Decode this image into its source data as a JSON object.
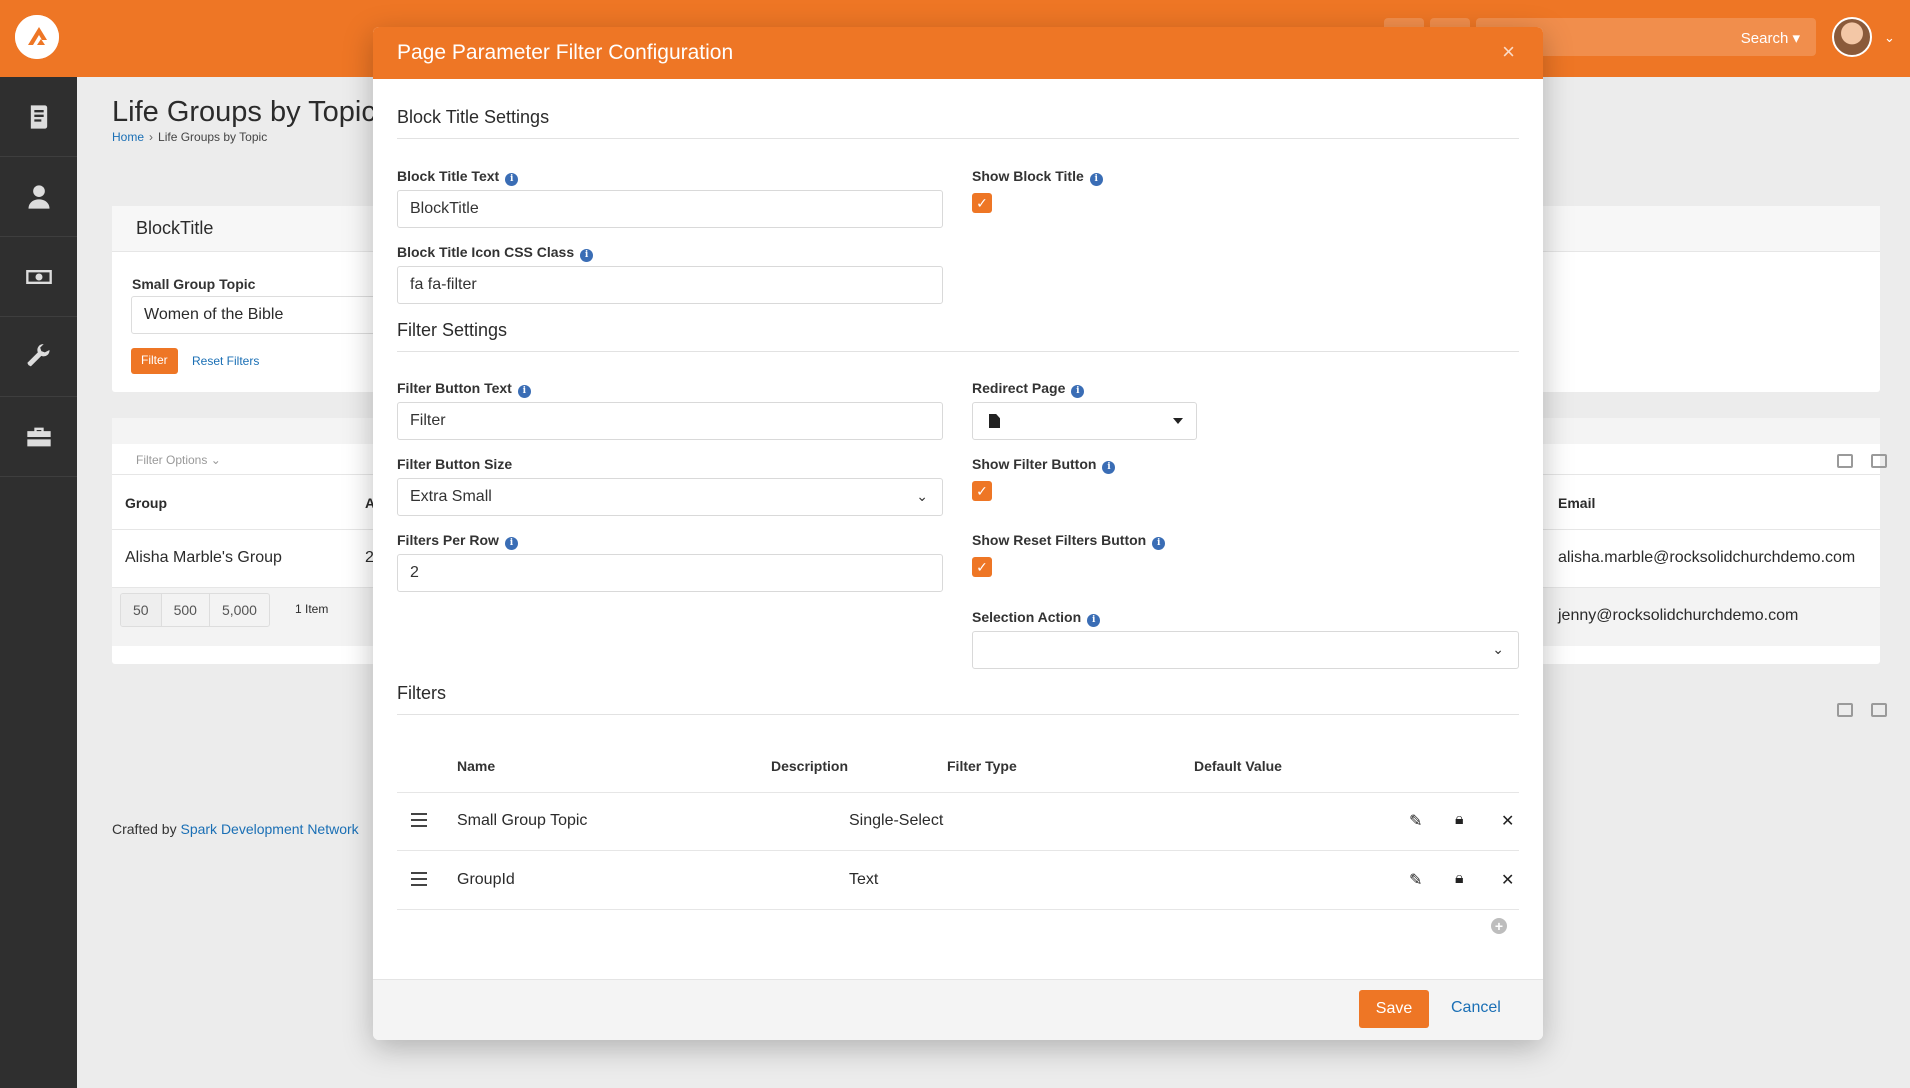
{
  "topbar": {
    "search_label": "Search ▾",
    "user_caret": "⌄"
  },
  "sidenav": {
    "items": [
      {
        "icon": "book-icon"
      },
      {
        "icon": "person-icon"
      },
      {
        "icon": "money-icon"
      },
      {
        "icon": "wrench-icon"
      },
      {
        "icon": "briefcase-icon"
      }
    ]
  },
  "page": {
    "title": "Life Groups by Topic",
    "breadcrumb": {
      "home": "Home",
      "separator": "›",
      "current": "Life Groups by Topic"
    }
  },
  "filter_block": {
    "title": "BlockTitle",
    "topic_label": "Small Group Topic",
    "topic_value": "Women of the Bible",
    "filter_button": "Filter",
    "reset_link": "Reset Filters"
  },
  "grid": {
    "filter_options": "Filter Options ⌄",
    "columns": {
      "group": "Group",
      "a_col": "A",
      "email": "Email"
    },
    "rows": [
      {
        "group": "Alisha Marble's Group",
        "a_col": "2",
        "email": "alisha.marble@rocksolidchurchdemo.com"
      },
      {
        "group": "",
        "email": "jenny@rocksolidchurchdemo.com"
      }
    ],
    "page_sizes": [
      "50",
      "500",
      "5,000"
    ],
    "item_count": "1 Item"
  },
  "footer": {
    "crafted_by": "Crafted by",
    "spark": "Spark Development Network"
  },
  "modal": {
    "title": "Page Parameter Filter Configuration",
    "close": "×",
    "block_title_settings": {
      "heading": "Block Title Settings",
      "block_title_text_label": "Block Title Text",
      "block_title_text_value": "BlockTitle",
      "show_block_title_label": "Show Block Title",
      "show_block_title_checked": true,
      "icon_css_label": "Block Title Icon CSS Class",
      "icon_css_value": "fa fa-filter"
    },
    "filter_settings": {
      "heading": "Filter Settings",
      "filter_button_text_label": "Filter Button Text",
      "filter_button_text_value": "Filter",
      "redirect_page_label": "Redirect Page",
      "filter_button_size_label": "Filter Button Size",
      "filter_button_size_value": "Extra Small",
      "show_filter_button_label": "Show Filter Button",
      "show_filter_button_checked": true,
      "filters_per_row_label": "Filters Per Row",
      "filters_per_row_value": "2",
      "show_reset_label": "Show Reset Filters Button",
      "show_reset_checked": true,
      "selection_action_label": "Selection Action",
      "selection_action_value": ""
    },
    "filters": {
      "heading": "Filters",
      "columns": {
        "name": "Name",
        "description": "Description",
        "filter_type": "Filter Type",
        "default_value": "Default Value"
      },
      "rows": [
        {
          "name": "Small Group Topic",
          "description": "",
          "filter_type": "Single-Select",
          "default_value": ""
        },
        {
          "name": "GroupId",
          "description": "",
          "filter_type": "Text",
          "default_value": ""
        }
      ]
    },
    "save": "Save",
    "cancel": "Cancel"
  }
}
